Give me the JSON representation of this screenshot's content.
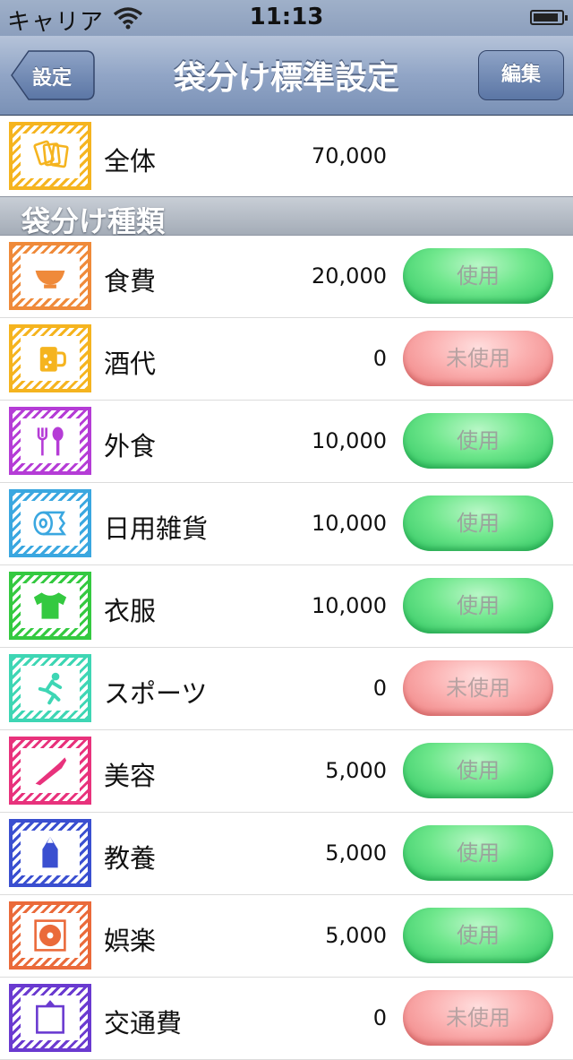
{
  "status_bar": {
    "carrier": "キャリア",
    "time": "11:13",
    "battery_level": 0.9
  },
  "nav": {
    "back_label": "設定",
    "title": "袋分け標準設定",
    "edit_label": "編集"
  },
  "total": {
    "label": "全体",
    "amount": "70,000",
    "icon": "cards-icon",
    "color": "#f5b41f"
  },
  "section_header": "袋分け種類",
  "categories": [
    {
      "label": "食費",
      "amount": "20,000",
      "status": "使用",
      "used": true,
      "icon": "bowl-icon",
      "color": "#ef8a3a"
    },
    {
      "label": "酒代",
      "amount": "0",
      "status": "未使用",
      "used": false,
      "icon": "beer-mug-icon",
      "color": "#f5b41f"
    },
    {
      "label": "外食",
      "amount": "10,000",
      "status": "使用",
      "used": true,
      "icon": "fork-spoon-icon",
      "color": "#b53cd6"
    },
    {
      "label": "日用雑貨",
      "amount": "10,000",
      "status": "使用",
      "used": true,
      "icon": "toilet-paper-icon",
      "color": "#3aa7e0"
    },
    {
      "label": "衣服",
      "amount": "10,000",
      "status": "使用",
      "used": true,
      "icon": "tshirt-icon",
      "color": "#34c940"
    },
    {
      "label": "スポーツ",
      "amount": "0",
      "status": "未使用",
      "used": false,
      "icon": "runner-icon",
      "color": "#3ed6b4"
    },
    {
      "label": "美容",
      "amount": "5,000",
      "status": "使用",
      "used": true,
      "icon": "razor-icon",
      "color": "#e8327c"
    },
    {
      "label": "教養",
      "amount": "5,000",
      "status": "使用",
      "used": true,
      "icon": "pencil-icon",
      "color": "#3a4fd0"
    },
    {
      "label": "娯楽",
      "amount": "5,000",
      "status": "使用",
      "used": true,
      "icon": "disc-icon",
      "color": "#ea6a3a"
    },
    {
      "label": "交通費",
      "amount": "0",
      "status": "未使用",
      "used": false,
      "icon": "train-icon",
      "color": "#6a3ad0"
    }
  ]
}
